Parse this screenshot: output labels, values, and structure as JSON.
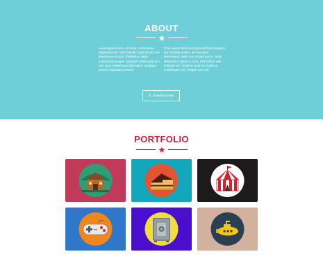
{
  "about": {
    "title": "ABOUT",
    "left_text": "Lorem ipsum dolor sit amet, consectetur adipiscing elit. Nam blandit turpis iaculis nisl pharetra eu luctus. Phasellus mattis malesuada feugiat. Quisque malesuada orci non risus scelerisque bibendum. Quisque viverra vulputate posuere.",
    "right_text": "Cras aptent taciti sociosqu ad litora torquent per conubia nostra, per inceptos himenaeos. Nulla non ornare purus. Nulla bibendum maximus urna, sed finibus velit tristique vel. Vivamus ante mi, mollis ut scelerisque nec, feugiat non nisi.",
    "download_label": "Download me!",
    "download_icon": "download-icon"
  },
  "portfolio": {
    "title": "PORTFOLIO",
    "items": [
      {
        "name": "cabin",
        "icon": "cabin-icon",
        "bg": "#c23a5a",
        "circle": "#2f9e74"
      },
      {
        "name": "cake",
        "icon": "cake-icon",
        "bg": "#13a7bd",
        "circle": "#e35530"
      },
      {
        "name": "circus",
        "icon": "circus-tent-icon",
        "bg": "#1c1a1a",
        "circle": "#ffffff"
      },
      {
        "name": "game",
        "icon": "game-controller-icon",
        "bg": "#3076c9",
        "circle": "#f0861e"
      },
      {
        "name": "safe",
        "icon": "safe-icon",
        "bg": "#4a0fcc",
        "circle": "#f2dd3b"
      },
      {
        "name": "submarine",
        "icon": "submarine-icon",
        "bg": "#d2b29f",
        "circle": "#2a3f52"
      }
    ]
  },
  "colors": {
    "about_bg": "#6fcfd8",
    "accent": "#cc1f3d"
  }
}
